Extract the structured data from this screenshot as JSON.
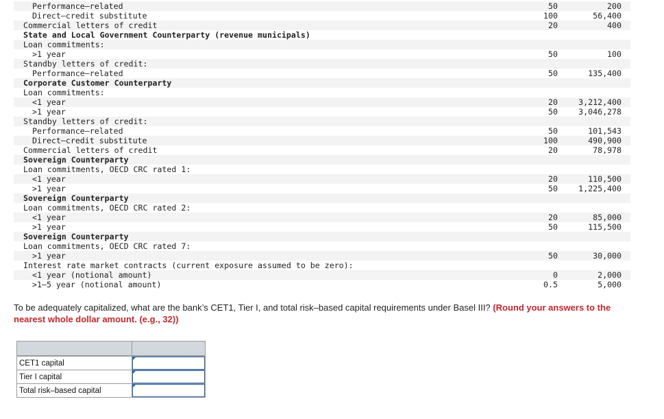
{
  "rows": [
    {
      "label": "Performance–related",
      "indent": 2,
      "bold": false,
      "cf": "50",
      "amount": "200"
    },
    {
      "label": "Direct–credit substitute",
      "indent": 2,
      "bold": false,
      "cf": "100",
      "amount": "56,400"
    },
    {
      "label": "Commercial letters of credit",
      "indent": 0,
      "bold": false,
      "cf": "20",
      "amount": "400"
    },
    {
      "label": "State and Local Government Counterparty (revenue municipals)",
      "indent": 0,
      "bold": true,
      "cf": "",
      "amount": ""
    },
    {
      "label": "Loan commitments:",
      "indent": 0,
      "bold": false,
      "cf": "",
      "amount": ""
    },
    {
      "label": ">1 year",
      "indent": 1,
      "bold": false,
      "cf": "50",
      "amount": "100"
    },
    {
      "label": "Standby letters of credit:",
      "indent": 0,
      "bold": false,
      "cf": "",
      "amount": ""
    },
    {
      "label": "Performance–related",
      "indent": 2,
      "bold": false,
      "cf": "50",
      "amount": "135,400"
    },
    {
      "label": "Corporate Customer Counterparty",
      "indent": 0,
      "bold": true,
      "cf": "",
      "amount": ""
    },
    {
      "label": "Loan commitments:",
      "indent": 0,
      "bold": false,
      "cf": "",
      "amount": ""
    },
    {
      "label": "<1 year",
      "indent": 1,
      "bold": false,
      "cf": "20",
      "amount": "3,212,400"
    },
    {
      "label": ">1 year",
      "indent": 1,
      "bold": false,
      "cf": "50",
      "amount": "3,046,278"
    },
    {
      "label": "Standby letters of credit:",
      "indent": 0,
      "bold": false,
      "cf": "",
      "amount": ""
    },
    {
      "label": "Performance–related",
      "indent": 2,
      "bold": false,
      "cf": "50",
      "amount": "101,543"
    },
    {
      "label": "Direct–credit substitute",
      "indent": 2,
      "bold": false,
      "cf": "100",
      "amount": "490,900"
    },
    {
      "label": "Commercial letters of credit",
      "indent": 0,
      "bold": false,
      "cf": "20",
      "amount": "78,978"
    },
    {
      "label": "Sovereign Counterparty",
      "indent": 0,
      "bold": true,
      "cf": "",
      "amount": ""
    },
    {
      "label": "Loan commitments, OECD CRC rated 1:",
      "indent": 0,
      "bold": false,
      "cf": "",
      "amount": ""
    },
    {
      "label": "<1 year",
      "indent": 1,
      "bold": false,
      "cf": "20",
      "amount": "110,500"
    },
    {
      "label": ">1 year",
      "indent": 1,
      "bold": false,
      "cf": "50",
      "amount": "1,225,400"
    },
    {
      "label": "Sovereign Counterparty",
      "indent": 0,
      "bold": true,
      "cf": "",
      "amount": ""
    },
    {
      "label": "Loan commitments, OECD CRC rated 2:",
      "indent": 0,
      "bold": false,
      "cf": "",
      "amount": ""
    },
    {
      "label": "<1 year",
      "indent": 1,
      "bold": false,
      "cf": "20",
      "amount": "85,000"
    },
    {
      "label": ">1 year",
      "indent": 1,
      "bold": false,
      "cf": "50",
      "amount": "115,500"
    },
    {
      "label": "Sovereign Counterparty",
      "indent": 0,
      "bold": true,
      "cf": "",
      "amount": ""
    },
    {
      "label": "Loan commitments, OECD CRC rated 7:",
      "indent": 0,
      "bold": false,
      "cf": "",
      "amount": ""
    },
    {
      "label": ">1 year",
      "indent": 1,
      "bold": false,
      "cf": "50",
      "amount": "30,000"
    },
    {
      "label": "Interest rate market contracts (current exposure assumed to be zero):",
      "indent": 0,
      "bold": false,
      "cf": "",
      "amount": ""
    },
    {
      "label": "<1 year (notional amount)",
      "indent": 1,
      "bold": false,
      "cf": "0",
      "amount": "2,000"
    },
    {
      "label": ">1–5 year (notional amount)",
      "indent": 1,
      "bold": false,
      "cf": "0.5",
      "amount": "5,000"
    }
  ],
  "question": {
    "text": "To be adequately capitalized, what are the bank’s CET1, Tier I, and total risk–based capital requirements under Basel III? ",
    "instruction": "(Round your answers to the nearest whole dollar amount. (e.g., 32))"
  },
  "answers": [
    {
      "label": "CET1 capital",
      "value": ""
    },
    {
      "label": "Tier I capital",
      "value": ""
    },
    {
      "label": "Total risk–based capital",
      "value": ""
    }
  ]
}
